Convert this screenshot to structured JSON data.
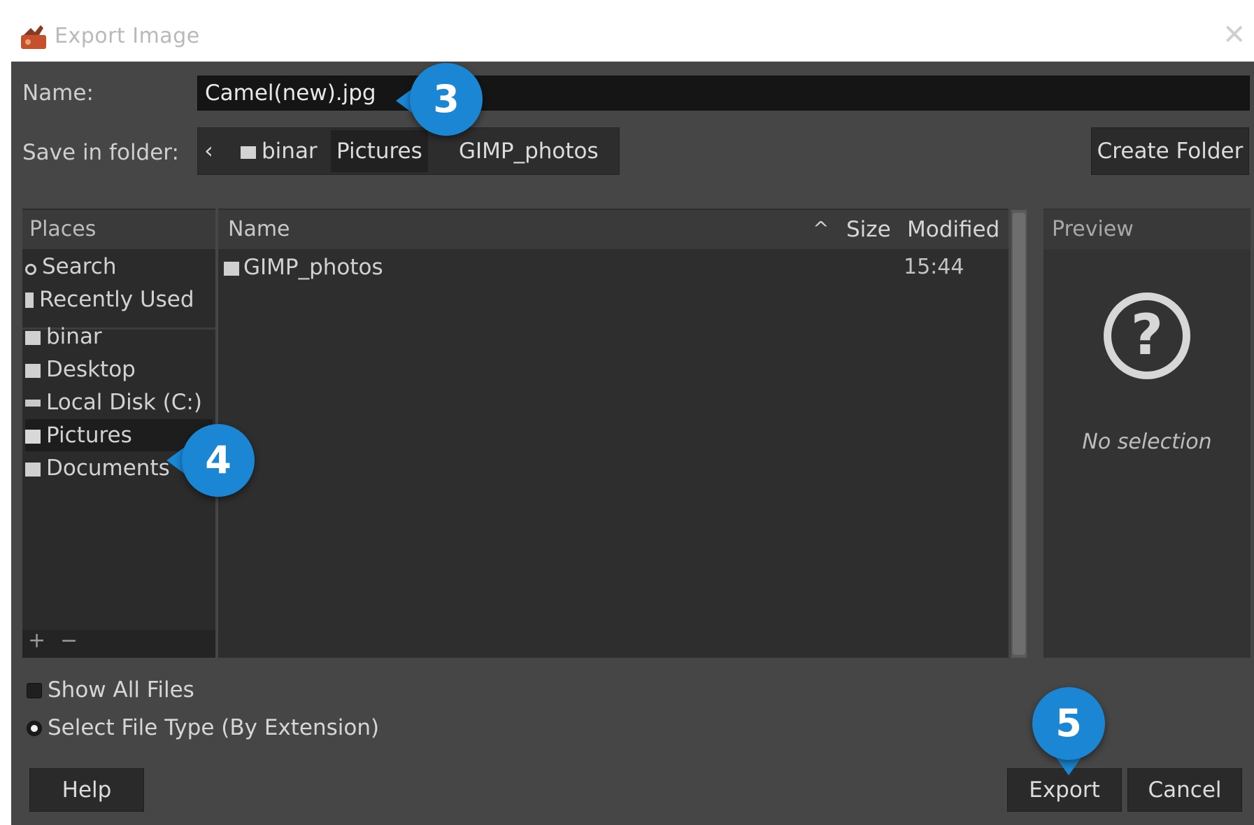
{
  "window": {
    "title": "Export Image",
    "close_icon": "close-icon"
  },
  "name_field": {
    "label": "Name:",
    "value": "Camel(new).jpg"
  },
  "folder": {
    "label": "Save in folder:",
    "back_glyph": "‹",
    "crumbs": [
      "binar",
      "Pictures",
      "GIMP_photos"
    ],
    "active_crumb": "Pictures",
    "create_folder_label": "Create Folder"
  },
  "places": {
    "header": "Places",
    "items": [
      {
        "label": "Search",
        "icon": "search-icon"
      },
      {
        "label": "Recently Used",
        "icon": "recent-icon"
      },
      {
        "label": "binar",
        "icon": "folder-icon"
      },
      {
        "label": "Desktop",
        "icon": "folder-icon"
      },
      {
        "label": "Local Disk (C:)",
        "icon": "drive-icon"
      },
      {
        "label": "Pictures",
        "icon": "pictures-folder-icon",
        "selected": true
      },
      {
        "label": "Documents",
        "icon": "folder-icon"
      }
    ],
    "add_label": "+",
    "remove_label": "−"
  },
  "files": {
    "columns": {
      "name": "Name",
      "size": "Size",
      "modified": "Modified"
    },
    "sort_glyph": "^",
    "rows": [
      {
        "name": "GIMP_photos",
        "size": "",
        "modified": "15:44",
        "icon": "folder-icon"
      }
    ]
  },
  "preview": {
    "header": "Preview",
    "icon": "question-icon",
    "empty_text": "No selection",
    "glyph": "?"
  },
  "options": {
    "show_all_files": "Show All Files",
    "select_file_type": "Select File Type (By Extension)"
  },
  "buttons": {
    "help": "Help",
    "export": "Export",
    "cancel": "Cancel"
  },
  "callouts": [
    "3",
    "4",
    "5"
  ],
  "colors": {
    "dialog_bg": "#464646",
    "callout": "#1a86d4",
    "input_bg": "#151515"
  }
}
